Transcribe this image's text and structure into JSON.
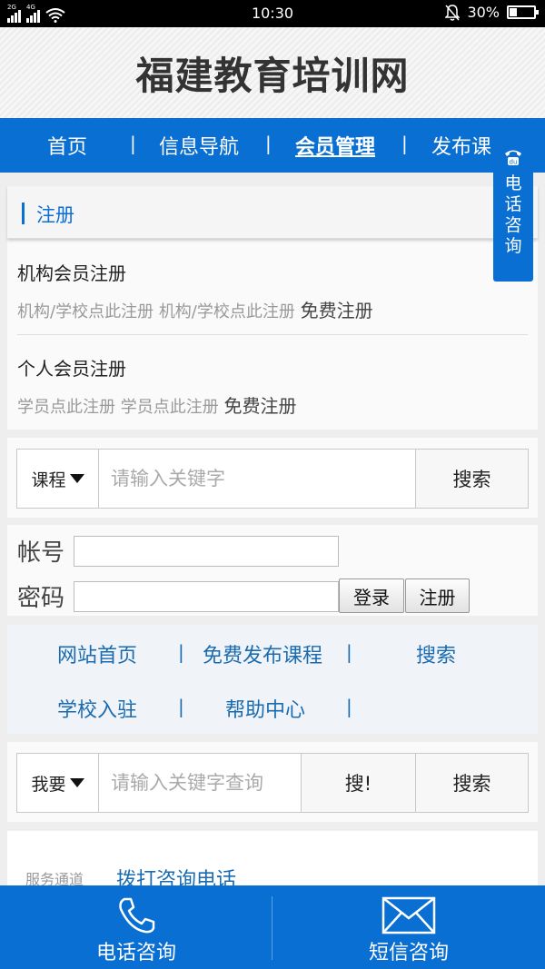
{
  "status_bar": {
    "sim1_label": "2G",
    "sim2_label": "4G",
    "time": "10:30",
    "battery_percent": "30%",
    "battery_level": 0.3
  },
  "header": {
    "site_title": "福建教育培训网"
  },
  "nav": {
    "items": [
      {
        "label": "首页"
      },
      {
        "label": "信息导航"
      },
      {
        "label": "会员管理"
      },
      {
        "label": "发布课"
      }
    ],
    "separator": "|",
    "active": "会员管理"
  },
  "float_phone": {
    "label": "电话咨询"
  },
  "register": {
    "header": "注册",
    "items": [
      {
        "title": "机构会员注册",
        "desc1": "机构/学校点此注册",
        "desc2": "机构/学校点此注册",
        "action": "免费注册"
      },
      {
        "title": "个人会员注册",
        "desc1": "学员点此注册",
        "desc2": "学员点此注册",
        "action": "免费注册"
      }
    ]
  },
  "search1": {
    "category": "课程",
    "placeholder": "请输入关键字",
    "button": "搜索"
  },
  "login": {
    "account_label": "帐号",
    "password_label": "密码",
    "login_button": "登录",
    "register_button": "注册"
  },
  "links": {
    "row1": [
      "网站首页",
      "免费发布课程",
      "搜索"
    ],
    "row2": [
      "学校入驻",
      "帮助中心"
    ],
    "separator": "|"
  },
  "search2": {
    "category": "我要",
    "placeholder": "请输入关键字查询",
    "button1": "搜!",
    "button2": "搜索"
  },
  "service": {
    "label": "服务通道",
    "link": "拨打咨询电话"
  },
  "bottom_bar": {
    "phone_label": "电话咨询",
    "sms_label": "短信咨询"
  },
  "colors": {
    "primary": "#0a6fd2",
    "link": "#1a6bb0"
  }
}
